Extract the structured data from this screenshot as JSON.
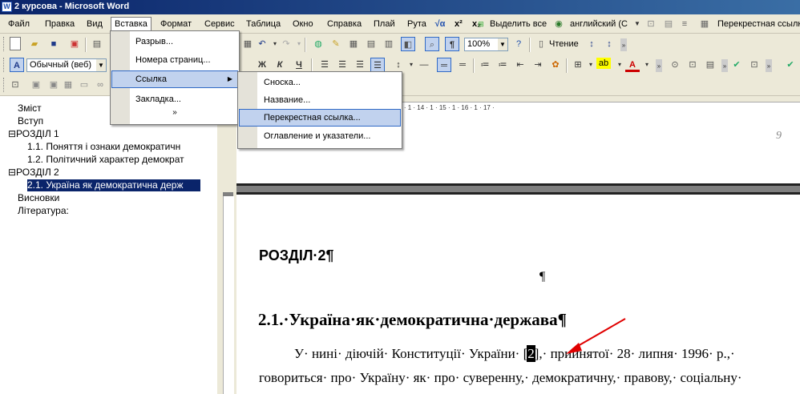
{
  "window": {
    "title": "2 курсова - Microsoft Word",
    "app_icon": "W"
  },
  "menubar": {
    "items": [
      {
        "name": "file",
        "label": "Файл"
      },
      {
        "name": "edit",
        "label": "Правка"
      },
      {
        "name": "view",
        "label": "Вид"
      },
      {
        "name": "insert",
        "label": "Вставка"
      },
      {
        "name": "format",
        "label": "Формат"
      },
      {
        "name": "service",
        "label": "Сервис"
      },
      {
        "name": "table",
        "label": "Таблица"
      },
      {
        "name": "window",
        "label": "Окно"
      },
      {
        "name": "help",
        "label": "Справка"
      },
      {
        "name": "plai",
        "label": "Плай"
      },
      {
        "name": "ruta",
        "label": "Рута"
      }
    ],
    "x2": "x²",
    "xsub": "x₂",
    "select_all": "Выделить все",
    "language": "английский (С",
    "crossref_button": "Перекрестная ссылк"
  },
  "toolbar1": {
    "zoom": "100%",
    "reading": "Чтение"
  },
  "toolbar2": {
    "style": "Обычный (веб)",
    "bold": "Ж",
    "italic": "К",
    "underline": "Ч"
  },
  "insert_menu": {
    "items": [
      {
        "label": "Разрыв..."
      },
      {
        "label": "Номера страниц..."
      },
      {
        "label": "Ссылка",
        "submenu": true
      },
      {
        "label": "Закладка..."
      }
    ],
    "more": "»"
  },
  "link_submenu": {
    "items": [
      {
        "label": "Сноска..."
      },
      {
        "label": "Название..."
      },
      {
        "label": "Перекрестная ссылка..."
      },
      {
        "label": "Оглавление и указатели..."
      }
    ]
  },
  "navpane": {
    "items": [
      {
        "label": "Зміст",
        "level": 1
      },
      {
        "label": "Вступ",
        "level": 1
      },
      {
        "label": "⊟РОЗДІЛ 1",
        "level": 0
      },
      {
        "label": "1.1. Поняття і ознаки демократичн",
        "level": 2
      },
      {
        "label": "1.2. Політичний характер демократ",
        "level": 2
      },
      {
        "label": "⊟РОЗДІЛ 2",
        "level": 0
      },
      {
        "label": "2.1. Україна як демократична держ",
        "level": 2,
        "selected": true
      },
      {
        "label": "Висновки",
        "level": 1
      },
      {
        "label": "Література:",
        "level": 1
      }
    ]
  },
  "ruler": {
    "ticks": "5 · 1 · 6 · 1 · 7 · 1 · 8 · 1 · 9 · 1 · 10 · 1 · 11 · 1 · 12 · 1 · 13 · 1 · 14 · 1 · 15 · 1 · 16 · 1 · 17 ·"
  },
  "document": {
    "page_number": "9",
    "heading_section": "РОЗДІЛ·2¶",
    "empty_para": "¶",
    "heading_sub": "2.1.·Україна·як·демократична·держава¶",
    "para1_before": "У· нині· діючій· Конституції· України· [",
    "para1_field": "2",
    "para1_after": "],· прийнятої· 28· липня· 1996· р.,·",
    "para2": "говориться· про· Україну· як· про· суверенну,· демократичну,· правову,· соціальну·"
  },
  "colors": {
    "highlight": "#c1d2ee",
    "highlight_border": "#316ac5",
    "arrow": "#e00000"
  }
}
